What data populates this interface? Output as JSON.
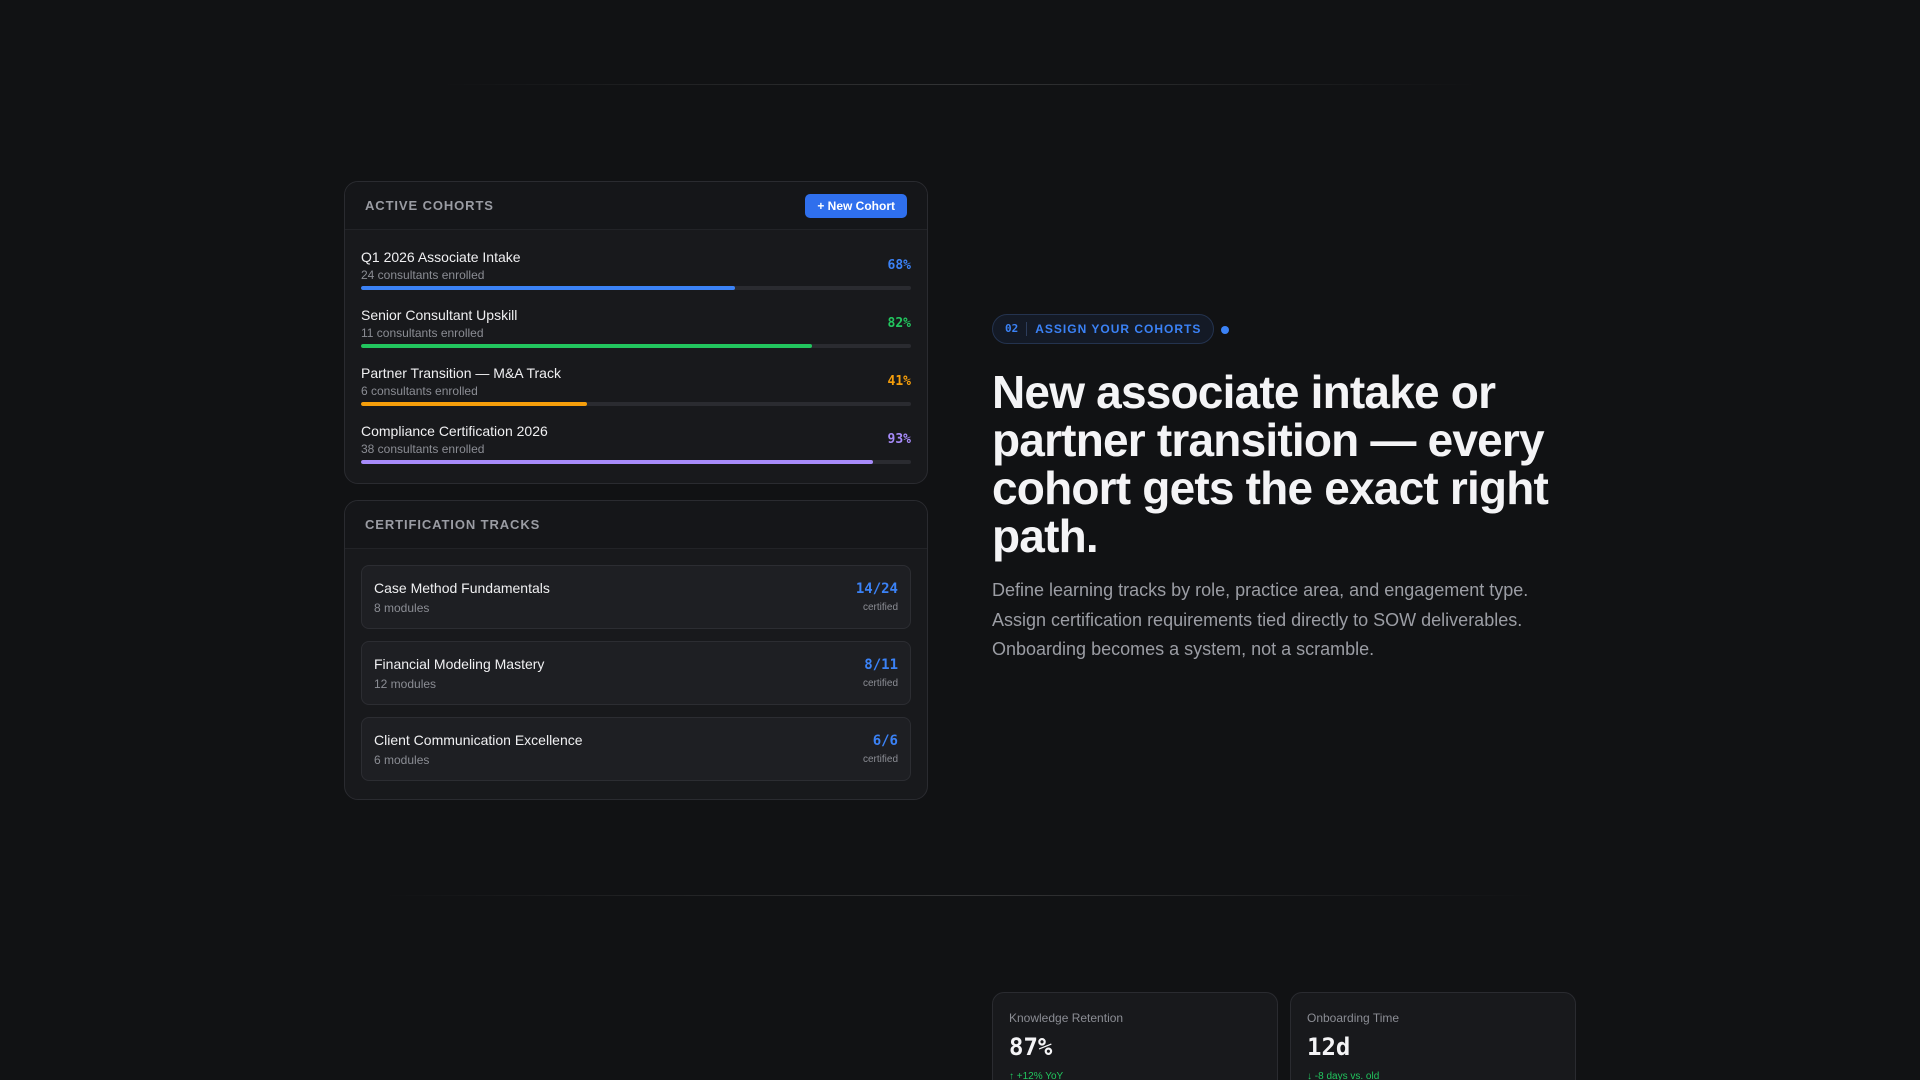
{
  "cohorts_panel": {
    "title": "ACTIVE COHORTS",
    "new_button": "+ New Cohort",
    "items": [
      {
        "name": "Q1 2026 Associate Intake",
        "sub": "24 consultants enrolled",
        "pct_label": "68%",
        "progress": 0.68,
        "color": "#3b82f6"
      },
      {
        "name": "Senior Consultant Upskill",
        "sub": "11 consultants enrolled",
        "pct_label": "82%",
        "progress": 0.82,
        "color": "#22c55e"
      },
      {
        "name": "Partner Transition — M&A Track",
        "sub": "6 consultants enrolled",
        "pct_label": "41%",
        "progress": 0.41,
        "color": "#f59e0b"
      },
      {
        "name": "Compliance Certification 2026",
        "sub": "38 consultants enrolled",
        "pct_label": "93%",
        "progress": 0.93,
        "color": "#a78bfa"
      }
    ]
  },
  "tracks_panel": {
    "title": "CERTIFICATION TRACKS",
    "items": [
      {
        "name": "Case Method Fundamentals",
        "sub": "8 modules",
        "count": "14/24",
        "note": "certified"
      },
      {
        "name": "Financial Modeling Mastery",
        "sub": "12 modules",
        "count": "8/11",
        "note": "certified"
      },
      {
        "name": "Client Communication Excellence",
        "sub": "6 modules",
        "count": "6/6",
        "note": "certified"
      }
    ]
  },
  "hero": {
    "badge_num": "02",
    "badge_label": "ASSIGN YOUR COHORTS",
    "accent": "#3b82f6",
    "title": "New associate intake or partner transition — every cohort gets the exact right path.",
    "description": "Define learning tracks by role, practice area, and engagement type. Assign certification requirements tied directly to SOW deliverables. Onboarding becomes a system, not a scramble."
  },
  "metrics": [
    {
      "label": "Knowledge Retention",
      "value": "87%",
      "delta": "↑ +12% YoY"
    },
    {
      "label": "Onboarding Time",
      "value": "12d",
      "delta": "↓ -8 days vs. old"
    }
  ]
}
